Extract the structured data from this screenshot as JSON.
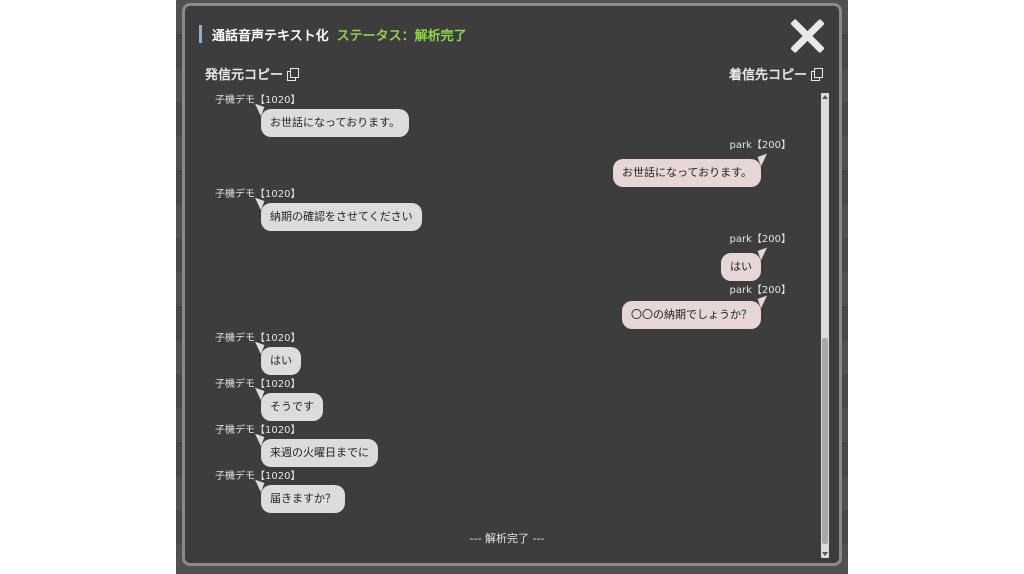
{
  "modal": {
    "title": "通話音声テキスト化",
    "status": "ステータス：解析完了",
    "copy_caller": "発信元コピー",
    "copy_callee": "着信先コピー",
    "end_text": "--- 解析完了 ---"
  },
  "messages": [
    {
      "side": "left",
      "speaker": "子機デモ【1020】",
      "text": "お世話になっております。"
    },
    {
      "side": "right",
      "speaker": "park【200】",
      "text": "お世話になっております。"
    },
    {
      "side": "left",
      "speaker": "子機デモ【1020】",
      "text": "納期の確認をさせてください"
    },
    {
      "side": "right",
      "speaker": "park【200】",
      "text": "はい"
    },
    {
      "side": "right",
      "speaker": "park【200】",
      "text": "〇〇の納期でしょうか？"
    },
    {
      "side": "left",
      "speaker": "子機デモ【1020】",
      "text": "はい"
    },
    {
      "side": "left",
      "speaker": "子機デモ【1020】",
      "text": "そうです"
    },
    {
      "side": "left",
      "speaker": "子機デモ【1020】",
      "text": "来週の火曜日までに"
    },
    {
      "side": "left",
      "speaker": "子機デモ【1020】",
      "text": "届きますか？"
    }
  ]
}
